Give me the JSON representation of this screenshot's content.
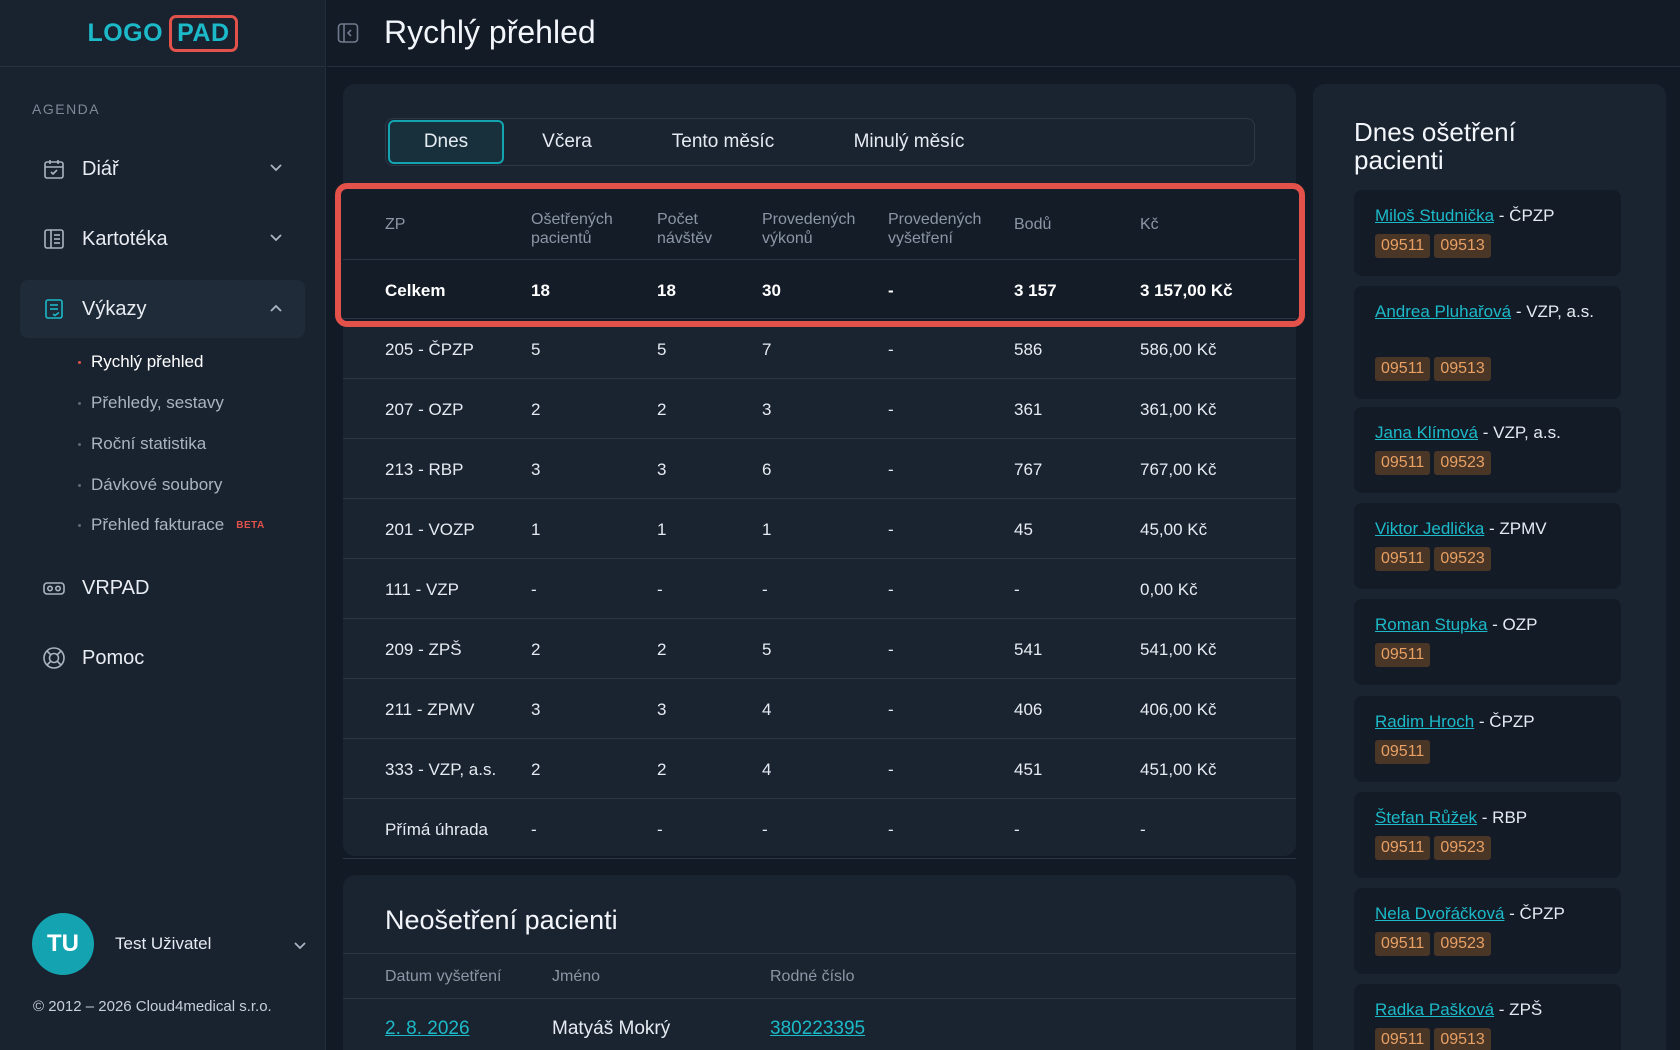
{
  "logo": {
    "part1": "LOGO",
    "part2": "PAD"
  },
  "sidebar": {
    "section_label": "AGENDA",
    "items": [
      {
        "label": "Diář",
        "icon": "calendar-icon"
      },
      {
        "label": "Kartotéka",
        "icon": "card-file-icon"
      },
      {
        "label": "Výkazy",
        "icon": "report-icon"
      },
      {
        "label": "VRPAD",
        "icon": "vr-icon"
      },
      {
        "label": "Pomoc",
        "icon": "lifebuoy-icon"
      }
    ],
    "sub_items": [
      {
        "label": "Rychlý přehled"
      },
      {
        "label": "Přehledy, sestavy"
      },
      {
        "label": "Roční statistika"
      },
      {
        "label": "Dávkové soubory"
      },
      {
        "label": "Přehled fakturace",
        "badge": "BETA"
      }
    ],
    "user": {
      "initials": "TU",
      "name": "Test Uživatel"
    },
    "copyright": "© 2012 – 2026 Cloud4medical s.r.o."
  },
  "header": {
    "title": "Rychlý přehled"
  },
  "tabs": [
    "Dnes",
    "Včera",
    "Tento měsíc",
    "Minulý měsíc"
  ],
  "table": {
    "headers": [
      {
        "l1": "ZP",
        "l2": ""
      },
      {
        "l1": "Ošetřených",
        "l2": "pacientů"
      },
      {
        "l1": "Počet",
        "l2": "návštěv"
      },
      {
        "l1": "Provedených",
        "l2": "výkonů"
      },
      {
        "l1": "Provedených",
        "l2": "vyšetření"
      },
      {
        "l1": "Bodů",
        "l2": ""
      },
      {
        "l1": "Kč",
        "l2": ""
      }
    ],
    "total": [
      "Celkem",
      "18",
      "18",
      "30",
      "-",
      "3 157",
      "3 157,00 Kč"
    ],
    "rows": [
      [
        "205 - ČPZP",
        "5",
        "5",
        "7",
        "-",
        "586",
        "586,00 Kč"
      ],
      [
        "207 - OZP",
        "2",
        "2",
        "3",
        "-",
        "361",
        "361,00 Kč"
      ],
      [
        "213 - RBP",
        "3",
        "3",
        "6",
        "-",
        "767",
        "767,00 Kč"
      ],
      [
        "201 - VOZP",
        "1",
        "1",
        "1",
        "-",
        "45",
        "45,00 Kč"
      ],
      [
        "111 - VZP",
        "-",
        "-",
        "-",
        "-",
        "-",
        "0,00 Kč"
      ],
      [
        "209 - ZPŠ",
        "2",
        "2",
        "5",
        "-",
        "541",
        "541,00 Kč"
      ],
      [
        "211 - ZPMV",
        "3",
        "3",
        "4",
        "-",
        "406",
        "406,00 Kč"
      ],
      [
        "333 - VZP, a.s.",
        "2",
        "2",
        "4",
        "-",
        "451",
        "451,00 Kč"
      ],
      [
        "Přímá úhrada",
        "-",
        "-",
        "-",
        "-",
        "-",
        "-"
      ]
    ]
  },
  "untreated": {
    "title": "Neošetření pacienti",
    "headers": [
      "Datum vyšetření",
      "Jméno",
      "Rodné číslo"
    ],
    "rows": [
      [
        "2. 8. 2026",
        "Matyáš Mokrý",
        "380223395"
      ]
    ]
  },
  "treated_today": {
    "title": "Dnes ošetření pacienti",
    "patients": [
      {
        "name": "Miloš Studnička",
        "insurer": " - ČPZP",
        "codes": [
          "09511",
          "09513"
        ]
      },
      {
        "name": "Andrea Pluhařová",
        "insurer": " - VZP, a.s.",
        "codes": [
          "09511",
          "09513"
        ]
      },
      {
        "name": "Jana Klímová",
        "insurer": " - VZP, a.s.",
        "codes": [
          "09511",
          "09523"
        ]
      },
      {
        "name": "Viktor Jedlička",
        "insurer": " - ZPMV",
        "codes": [
          "09511",
          "09523"
        ]
      },
      {
        "name": "Roman Stupka",
        "insurer": " - OZP",
        "codes": [
          "09511"
        ]
      },
      {
        "name": "Radim Hroch",
        "insurer": " - ČPZP",
        "codes": [
          "09511"
        ]
      },
      {
        "name": "Štefan Růžek",
        "insurer": " - RBP",
        "codes": [
          "09511",
          "09523"
        ]
      },
      {
        "name": "Nela Dvořáčková",
        "insurer": " - ČPZP",
        "codes": [
          "09511",
          "09523"
        ]
      },
      {
        "name": "Radka Pašková",
        "insurer": " - ZPŠ",
        "codes": [
          "09511",
          "09513"
        ]
      }
    ]
  },
  "colors": {
    "accent": "#1cb9c8",
    "highlight": "#e2524a",
    "code_bg": "#4a3626",
    "code_text": "#e8a064"
  }
}
